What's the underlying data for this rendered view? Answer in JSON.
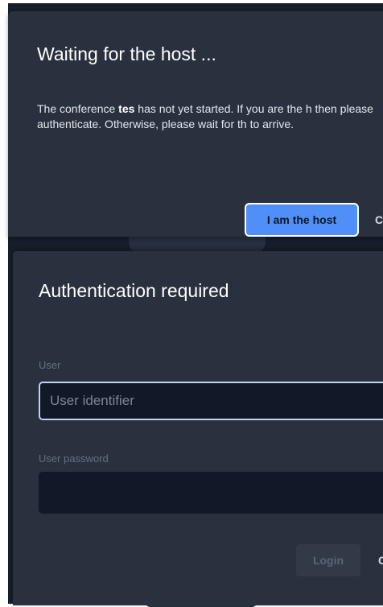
{
  "wait_dialog": {
    "title": "Waiting for the host ...",
    "message_prefix": "The conference ",
    "conference_name": "tes",
    "message_suffix": " has not yet started. If you are the h then please authenticate. Otherwise, please wait for th to arrive.",
    "host_button_label": "I am the host",
    "cancel_button_partial": "C"
  },
  "auth_dialog": {
    "title": "Authentication required",
    "user_label": "User",
    "user_placeholder": "User identifier",
    "password_label": "User password",
    "password_value": "",
    "login_button_label": "Login",
    "cancel_button_partial": "C"
  },
  "colors": {
    "backdrop": "#161e2c",
    "dialog_bg": "#29313f",
    "primary": "#4f8ff7",
    "input_bg": "#111827",
    "input_focus_border": "#c2d3f2",
    "disabled_button_bg": "#323a48",
    "muted_label": "#666f7e"
  }
}
